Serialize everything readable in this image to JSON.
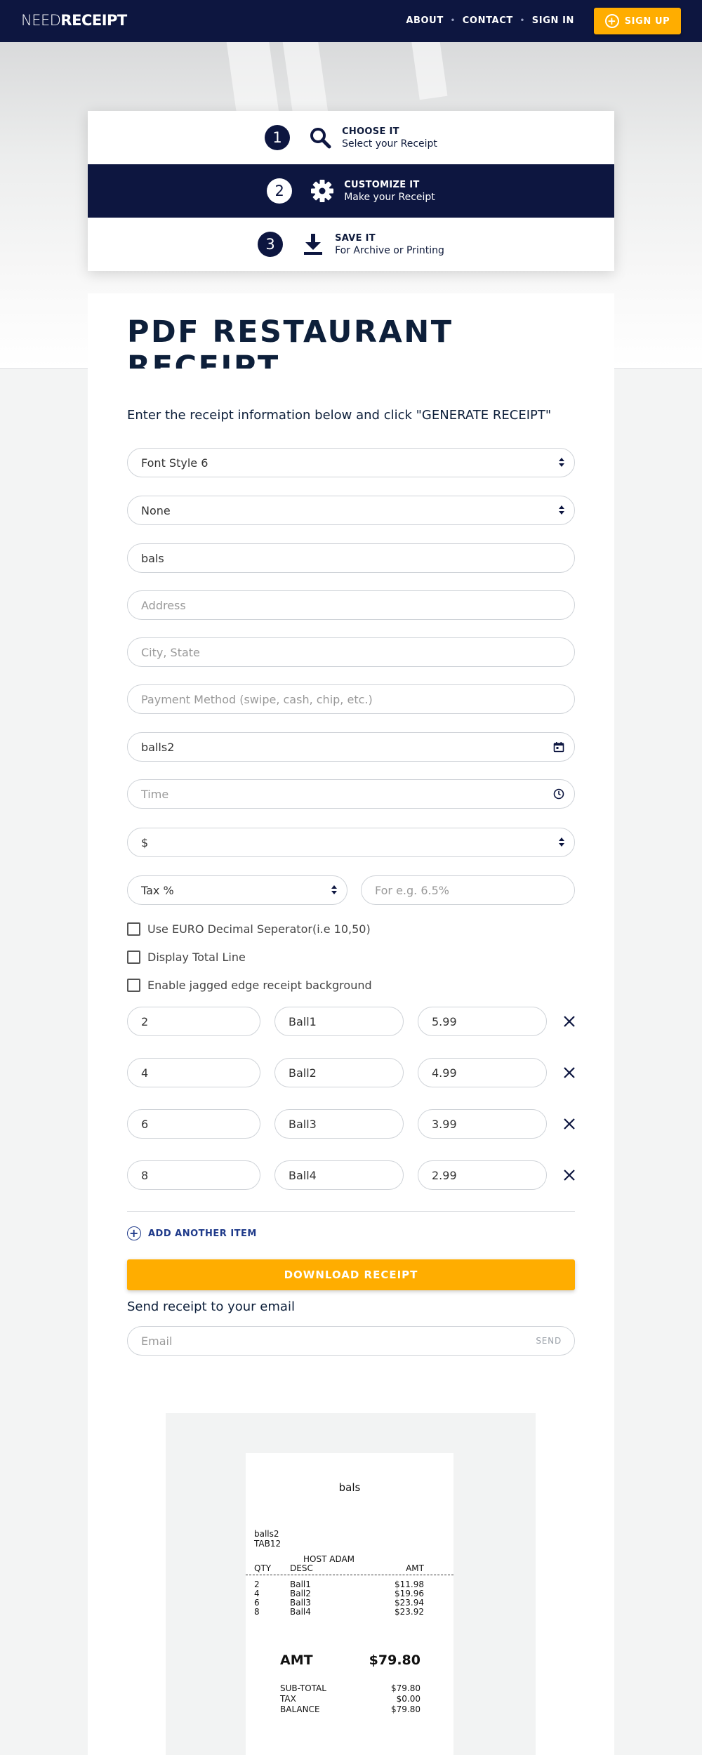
{
  "header": {
    "logo_thin": "NEED",
    "logo_bold": "RECEIPT",
    "nav": [
      "ABOUT",
      "CONTACT",
      "SIGN IN"
    ],
    "signup_label": "SIGN UP"
  },
  "steps": [
    {
      "number": "1",
      "title": "CHOOSE IT",
      "subtitle": "Select your Receipt",
      "icon": "search-icon"
    },
    {
      "number": "2",
      "title": "CUSTOMIZE IT",
      "subtitle": "Make your Receipt",
      "icon": "gear-icon"
    },
    {
      "number": "3",
      "title": "SAVE IT",
      "subtitle": "For Archive or Printing",
      "icon": "download-icon"
    }
  ],
  "page_title": "PDF RESTAURANT RECEIPT",
  "form": {
    "intro": "Enter the receipt information below and click \"GENERATE RECEIPT\"",
    "font_style": "Font Style 6",
    "logo_select": "None",
    "business_name": "bals",
    "address_placeholder": "Address",
    "city_placeholder": "City, State",
    "payment_placeholder": "Payment Method (swipe, cash, chip, etc.)",
    "date_value": "balls2",
    "time_placeholder": "Time",
    "currency": "$",
    "tax_select": "Tax %",
    "tax_placeholder": "For e.g. 6.5%",
    "checkboxes": [
      "Use EURO Decimal Seperator(i.e 10,50)",
      "Display Total Line",
      "Enable jagged edge receipt background"
    ],
    "items": [
      {
        "qty": "2",
        "desc": "Ball1",
        "price": "5.99"
      },
      {
        "qty": "4",
        "desc": "Ball2",
        "price": "4.99"
      },
      {
        "qty": "6",
        "desc": "Ball3",
        "price": "3.99"
      },
      {
        "qty": "8",
        "desc": "Ball4",
        "price": "2.99"
      }
    ],
    "add_item": "ADD ANOTHER ITEM",
    "download": "DOWNLOAD RECEIPT",
    "send_label": "Send receipt to your email",
    "email_placeholder": "Email",
    "send_button": "SEND"
  },
  "receipt": {
    "name": "bals",
    "date": "balls2",
    "tab": "TAB12",
    "host": "HOST ADAM",
    "col_qty": "QTY",
    "col_desc": "DESC",
    "col_amt": "AMT",
    "lines": [
      {
        "qty": "2",
        "desc": "Ball1",
        "amt": "$11.98"
      },
      {
        "qty": "4",
        "desc": "Ball2",
        "amt": "$19.96"
      },
      {
        "qty": "6",
        "desc": "Ball3",
        "amt": "$23.94"
      },
      {
        "qty": "8",
        "desc": "Ball4",
        "amt": "$23.92"
      }
    ],
    "amt_label": "AMT",
    "amt_value": "$79.80",
    "subtotal_label": "SUB-TOTAL",
    "subtotal_value": "$79.80",
    "tax_label": "TAX",
    "tax_value": "$0.00",
    "balance_label": "BALANCE",
    "balance_value": "$79.80"
  },
  "colors": {
    "navy": "#0d1640",
    "accent": "#ffad00"
  }
}
